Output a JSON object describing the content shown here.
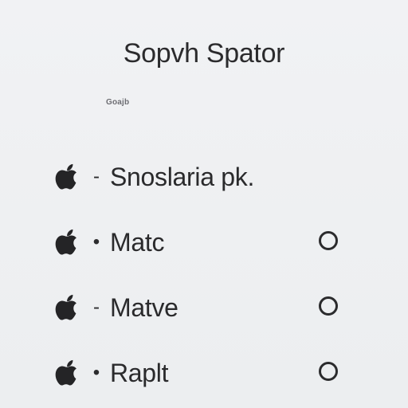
{
  "header": {
    "title": "Sopvh Spator",
    "subtitle": "Goajb"
  },
  "options": [
    {
      "label": "Snoslaria pk.",
      "separator": "-",
      "icon": "apple-icon",
      "has_radio": false
    },
    {
      "label": "Matc",
      "separator": "•",
      "icon": "apple-icon",
      "has_radio": true,
      "selected": false
    },
    {
      "label": "Matve",
      "separator": "-",
      "icon": "apple-icon",
      "has_radio": true,
      "selected": false
    },
    {
      "label": "Raplt",
      "separator": "•",
      "icon": "apple-icon",
      "has_radio": true,
      "selected": false
    }
  ],
  "colors": {
    "background": "#eef0f2",
    "text": "#2a2a2c",
    "subtitle": "#6d6d72"
  }
}
